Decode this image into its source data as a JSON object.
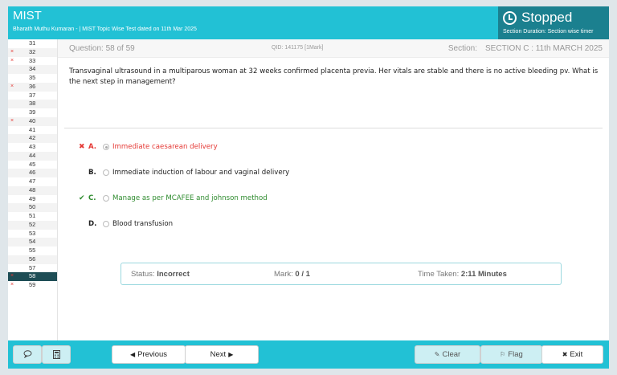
{
  "header": {
    "title": "MIST",
    "subtitle": "Bharath Muthu Kumaran - | MIST Topic Wise Test dated on 11th Mar 2025",
    "status": "Stopped",
    "status_sub": "Section Duration: Section wise timer"
  },
  "sidebar": {
    "items": [
      {
        "num": "31",
        "mark": ""
      },
      {
        "num": "32",
        "mark": "×"
      },
      {
        "num": "33",
        "mark": "×"
      },
      {
        "num": "34",
        "mark": ""
      },
      {
        "num": "35",
        "mark": ""
      },
      {
        "num": "36",
        "mark": "×"
      },
      {
        "num": "37",
        "mark": ""
      },
      {
        "num": "38",
        "mark": ""
      },
      {
        "num": "39",
        "mark": ""
      },
      {
        "num": "40",
        "mark": "×"
      },
      {
        "num": "41",
        "mark": ""
      },
      {
        "num": "42",
        "mark": ""
      },
      {
        "num": "43",
        "mark": ""
      },
      {
        "num": "44",
        "mark": ""
      },
      {
        "num": "45",
        "mark": ""
      },
      {
        "num": "46",
        "mark": ""
      },
      {
        "num": "47",
        "mark": ""
      },
      {
        "num": "48",
        "mark": ""
      },
      {
        "num": "49",
        "mark": ""
      },
      {
        "num": "50",
        "mark": ""
      },
      {
        "num": "51",
        "mark": ""
      },
      {
        "num": "52",
        "mark": ""
      },
      {
        "num": "53",
        "mark": ""
      },
      {
        "num": "54",
        "mark": ""
      },
      {
        "num": "55",
        "mark": ""
      },
      {
        "num": "56",
        "mark": ""
      },
      {
        "num": "57",
        "mark": ""
      },
      {
        "num": "58",
        "mark": "×",
        "active": true
      },
      {
        "num": "59",
        "mark": "×"
      }
    ]
  },
  "question": {
    "number_label": "Question: 58 of 59",
    "qid": "QID: 141175  [1Mark]",
    "section_label": "Section:",
    "section_value": "SECTION C : 11th MARCH 2025",
    "text": "Transvaginal ultrasound in a multiparous woman at 32 weeks confirmed placenta previa. Her vitals are stable and there is no active bleeding pv. What is the next step in management?"
  },
  "options": [
    {
      "letter": "A.",
      "text": "Immediate caesarean delivery",
      "state": "✖",
      "status": "wrong",
      "checked": true
    },
    {
      "letter": "B.",
      "text": "Immediate induction of labour and vaginal delivery",
      "state": "",
      "status": "",
      "checked": false
    },
    {
      "letter": "C.",
      "text": "Manage as per MCAFEE and johnson method",
      "state": "✔",
      "status": "right",
      "checked": false
    },
    {
      "letter": "D.",
      "text": "Blood transfusion",
      "state": "",
      "status": "",
      "checked": false
    }
  ],
  "result": {
    "status_label": "Status:",
    "status_value": "Incorrect",
    "mark_label": "Mark:",
    "mark_value": "0 / 1",
    "time_label": "Time Taken:",
    "time_value": "2:11 Minutes"
  },
  "footer": {
    "comment_icon": "speech-bubble-icon",
    "calc_icon": "calculator-icon",
    "prev_label": "Previous",
    "next_label": "Next",
    "clear_label": "Clear",
    "flag_label": "Flag",
    "exit_label": "Exit"
  },
  "colors": {
    "header": "#22c1d5",
    "status_box": "#1b808f",
    "wrong": "#e53935",
    "correct": "#2e8b2e",
    "active_row": "#1e4d55"
  }
}
